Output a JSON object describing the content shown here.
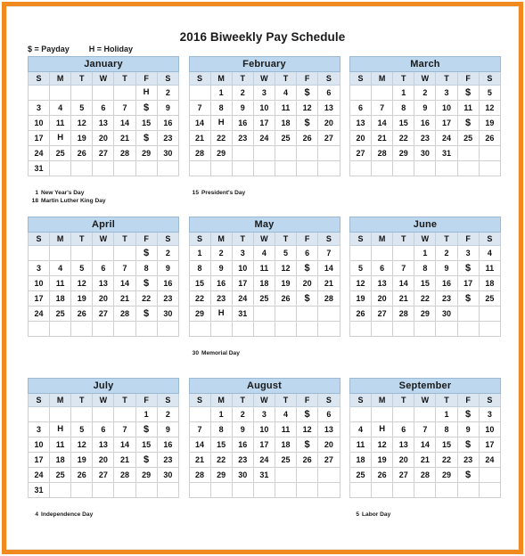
{
  "page": {
    "title": "2016 Biweekly Pay Schedule",
    "frame_color": "#f08a1e",
    "header_color": "#bdd7ee",
    "dow_color": "#dce6f1"
  },
  "legend": {
    "payday": "$ = Payday",
    "holiday": "H = Holiday"
  },
  "dow": [
    "S",
    "M",
    "T",
    "W",
    "T",
    "F",
    "S"
  ],
  "months": [
    {
      "name": "January",
      "weeks": [
        [
          "",
          "",
          "",
          "",
          "",
          "H",
          "2"
        ],
        [
          "3",
          "4",
          "5",
          "6",
          "7",
          "$",
          "9"
        ],
        [
          "10",
          "11",
          "12",
          "13",
          "14",
          "15",
          "16"
        ],
        [
          "17",
          "H",
          "19",
          "20",
          "21",
          "$",
          "23"
        ],
        [
          "24",
          "25",
          "26",
          "27",
          "28",
          "29",
          "30"
        ],
        [
          "31",
          "",
          "",
          "",
          "",
          "",
          ""
        ]
      ],
      "notes": [
        {
          "day": "1",
          "label": "New Year's Day"
        },
        {
          "day": "18",
          "label": "Martin Luther King Day"
        }
      ]
    },
    {
      "name": "February",
      "weeks": [
        [
          "",
          "1",
          "2",
          "3",
          "4",
          "$",
          "6"
        ],
        [
          "7",
          "8",
          "9",
          "10",
          "11",
          "12",
          "13"
        ],
        [
          "14",
          "H",
          "16",
          "17",
          "18",
          "$",
          "20"
        ],
        [
          "21",
          "22",
          "23",
          "24",
          "25",
          "26",
          "27"
        ],
        [
          "28",
          "29",
          "",
          "",
          "",
          "",
          ""
        ],
        [
          "",
          "",
          "",
          "",
          "",
          "",
          ""
        ]
      ],
      "notes": [
        {
          "day": "15",
          "label": "President's Day"
        }
      ]
    },
    {
      "name": "March",
      "weeks": [
        [
          "",
          "",
          "1",
          "2",
          "3",
          "$",
          "5"
        ],
        [
          "6",
          "7",
          "8",
          "9",
          "10",
          "11",
          "12"
        ],
        [
          "13",
          "14",
          "15",
          "16",
          "17",
          "$",
          "19"
        ],
        [
          "20",
          "21",
          "22",
          "23",
          "24",
          "25",
          "26"
        ],
        [
          "27",
          "28",
          "29",
          "30",
          "31",
          "",
          ""
        ],
        [
          "",
          "",
          "",
          "",
          "",
          "",
          ""
        ]
      ],
      "notes": []
    },
    {
      "name": "April",
      "weeks": [
        [
          "",
          "",
          "",
          "",
          "",
          "$",
          "2"
        ],
        [
          "3",
          "4",
          "5",
          "6",
          "7",
          "8",
          "9"
        ],
        [
          "10",
          "11",
          "12",
          "13",
          "14",
          "$",
          "16"
        ],
        [
          "17",
          "18",
          "19",
          "20",
          "21",
          "22",
          "23"
        ],
        [
          "24",
          "25",
          "26",
          "27",
          "28",
          "$",
          "30"
        ],
        [
          "",
          "",
          "",
          "",
          "",
          "",
          ""
        ]
      ],
      "notes": []
    },
    {
      "name": "May",
      "weeks": [
        [
          "1",
          "2",
          "3",
          "4",
          "5",
          "6",
          "7"
        ],
        [
          "8",
          "9",
          "10",
          "11",
          "12",
          "$",
          "14"
        ],
        [
          "15",
          "16",
          "17",
          "18",
          "19",
          "20",
          "21"
        ],
        [
          "22",
          "23",
          "24",
          "25",
          "26",
          "$",
          "28"
        ],
        [
          "29",
          "H",
          "31",
          "",
          "",
          "",
          ""
        ],
        [
          "",
          "",
          "",
          "",
          "",
          "",
          ""
        ]
      ],
      "notes": [
        {
          "day": "30",
          "label": "Memorial Day"
        }
      ]
    },
    {
      "name": "June",
      "weeks": [
        [
          "",
          "",
          "",
          "1",
          "2",
          "3",
          "4"
        ],
        [
          "5",
          "6",
          "7",
          "8",
          "9",
          "$",
          "11"
        ],
        [
          "12",
          "13",
          "14",
          "15",
          "16",
          "17",
          "18"
        ],
        [
          "19",
          "20",
          "21",
          "22",
          "23",
          "$",
          "25"
        ],
        [
          "26",
          "27",
          "28",
          "29",
          "30",
          "",
          ""
        ],
        [
          "",
          "",
          "",
          "",
          "",
          "",
          ""
        ]
      ],
      "notes": []
    },
    {
      "name": "July",
      "weeks": [
        [
          "",
          "",
          "",
          "",
          "",
          "1",
          "2"
        ],
        [
          "3",
          "H",
          "5",
          "6",
          "7",
          "$",
          "9"
        ],
        [
          "10",
          "11",
          "12",
          "13",
          "14",
          "15",
          "16"
        ],
        [
          "17",
          "18",
          "19",
          "20",
          "21",
          "$",
          "23"
        ],
        [
          "24",
          "25",
          "26",
          "27",
          "28",
          "29",
          "30"
        ],
        [
          "31",
          "",
          "",
          "",
          "",
          "",
          ""
        ]
      ],
      "notes": [
        {
          "day": "4",
          "label": "Independence Day"
        }
      ]
    },
    {
      "name": "August",
      "weeks": [
        [
          "",
          "1",
          "2",
          "3",
          "4",
          "$",
          "6"
        ],
        [
          "7",
          "8",
          "9",
          "10",
          "11",
          "12",
          "13"
        ],
        [
          "14",
          "15",
          "16",
          "17",
          "18",
          "$",
          "20"
        ],
        [
          "21",
          "22",
          "23",
          "24",
          "25",
          "26",
          "27"
        ],
        [
          "28",
          "29",
          "30",
          "31",
          "",
          "",
          ""
        ],
        [
          "",
          "",
          "",
          "",
          "",
          "",
          ""
        ]
      ],
      "notes": []
    },
    {
      "name": "September",
      "weeks": [
        [
          "",
          "",
          "",
          "",
          "1",
          "$",
          "3"
        ],
        [
          "4",
          "H",
          "6",
          "7",
          "8",
          "9",
          "10"
        ],
        [
          "11",
          "12",
          "13",
          "14",
          "15",
          "$",
          "17"
        ],
        [
          "18",
          "19",
          "20",
          "21",
          "22",
          "23",
          "24"
        ],
        [
          "25",
          "26",
          "27",
          "28",
          "29",
          "$",
          ""
        ],
        [
          "",
          "",
          "",
          "",
          "",
          "",
          ""
        ]
      ],
      "notes": [
        {
          "day": "5",
          "label": "Labor Day"
        }
      ]
    }
  ],
  "layout": {
    "row_tops": [
      63,
      243,
      424
    ],
    "notes_tops": [
      212,
      392,
      573
    ]
  }
}
